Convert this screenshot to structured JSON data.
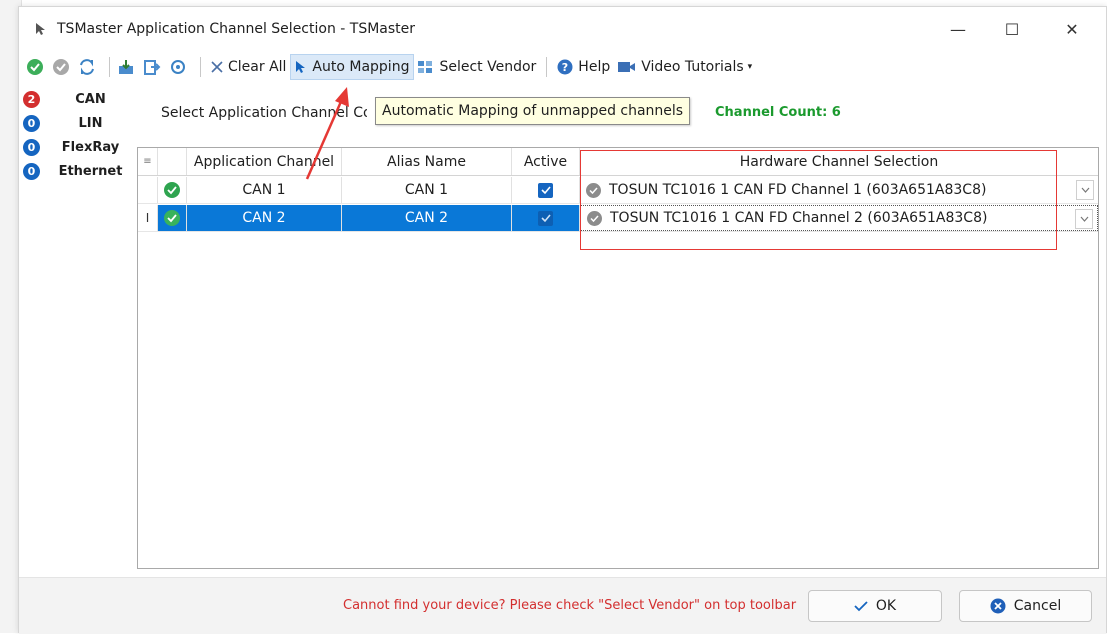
{
  "window": {
    "title": "TSMaster Application Channel Selection - TSMaster",
    "minimize": "—",
    "maximize": "☐",
    "close": "✕"
  },
  "toolbar": {
    "clear_all": "Clear All",
    "auto_mapping": "Auto Mapping",
    "select_vendor": "Select Vendor",
    "help": "Help",
    "video_tutorials": "Video Tutorials"
  },
  "protocols": [
    {
      "count": "2",
      "label": "CAN",
      "color": "#d32f2f"
    },
    {
      "count": "0",
      "label": "LIN",
      "color": "#1565c0"
    },
    {
      "count": "0",
      "label": "FlexRay",
      "color": "#1565c0"
    },
    {
      "count": "0",
      "label": "Ethernet",
      "color": "#1565c0"
    }
  ],
  "select": {
    "label": "Select Application Channel Count",
    "count_label": "Channel Count: 6"
  },
  "tooltip": "Automatic Mapping of unmapped channels",
  "grid": {
    "headers": {
      "app_channel": "Application Channel",
      "alias": "Alias Name",
      "active": "Active",
      "hw_selection": "Hardware Channel Selection"
    },
    "rows": [
      {
        "app_channel": "CAN 1",
        "alias": "CAN 1",
        "hw": "TOSUN TC1016 1 CAN FD Channel 1 (603A651A83C8)"
      },
      {
        "app_channel": "CAN 2",
        "alias": "CAN 2",
        "hw": "TOSUN TC1016 1 CAN FD Channel 2 (603A651A83C8)"
      }
    ]
  },
  "footer": {
    "message": "Cannot find your device? Please check \"Select Vendor\" on top toolbar",
    "ok": "OK",
    "cancel": "Cancel"
  },
  "colors": {
    "selected_row": "#0a78d7",
    "annotation": "#e53935",
    "status_ok": "#2ea44f"
  }
}
